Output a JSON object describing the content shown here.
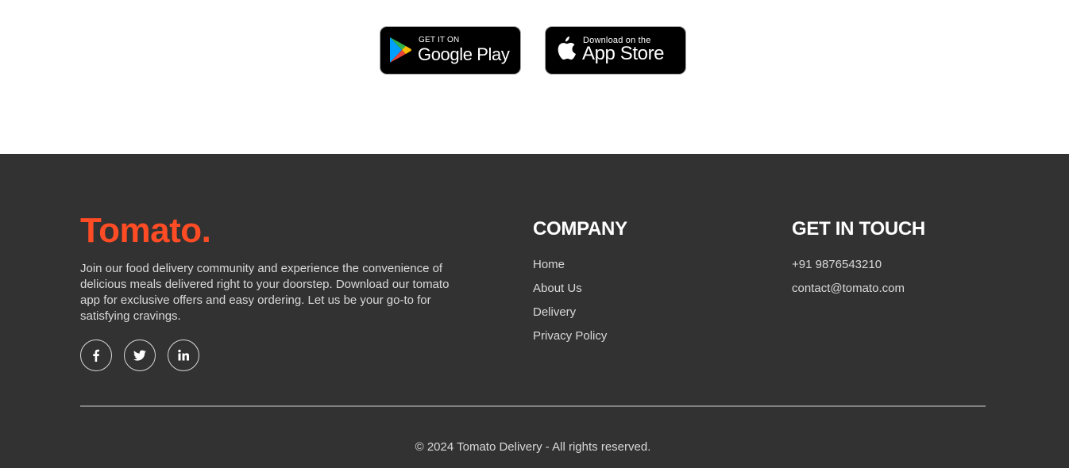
{
  "badges": {
    "google": {
      "small": "GET IT ON",
      "large": "Google Play",
      "icon": "google-play-icon"
    },
    "apple": {
      "small": "Download on the",
      "large": "App Store",
      "icon": "apple-icon"
    }
  },
  "footer": {
    "logo": "Tomato.",
    "description": "Join our food delivery community and experience the convenience of delicious meals delivered right to your doorstep. Download our tomato app for exclusive offers and easy ordering. Let us be your go-to for satisfying cravings.",
    "socials": [
      {
        "icon": "facebook-icon"
      },
      {
        "icon": "twitter-icon"
      },
      {
        "icon": "linkedin-icon"
      }
    ],
    "company": {
      "title": "COMPANY",
      "links": [
        "Home",
        "About Us",
        "Delivery",
        "Privacy Policy"
      ]
    },
    "contact": {
      "title": "GET IN TOUCH",
      "phone": "+91 9876543210",
      "email": "contact@tomato.com"
    },
    "copyright": "© 2024 Tomato Delivery - All rights reserved."
  },
  "colors": {
    "brand": "#ff4c24",
    "footer_bg": "#323232",
    "footer_text": "#d9d9d9"
  }
}
